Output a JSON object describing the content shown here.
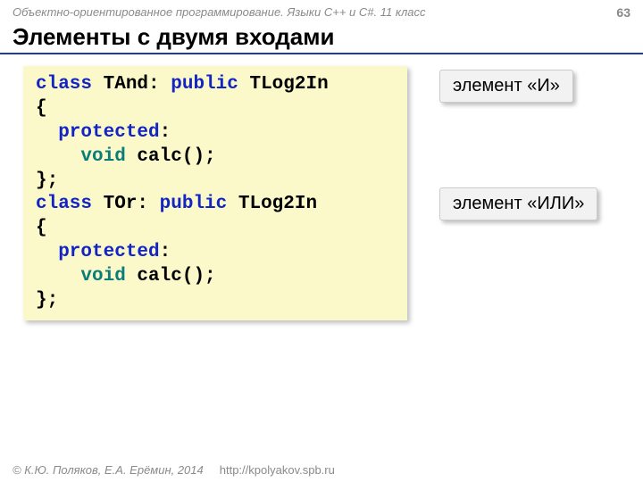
{
  "header": {
    "course": "Объектно-ориентированное программирование. Языки C++ и C#. 11 класс",
    "page": "63"
  },
  "title": "Элементы с двумя входами",
  "code": {
    "l1_kw1": "class",
    "l1_name": " TAnd: ",
    "l1_kw2": "public",
    "l1_base": " TLog2In",
    "l2": "{",
    "l3_kw": "  protected",
    "l3_colon": ":",
    "l4_kw": "    void",
    "l4_rest": " calc();",
    "l5": "};",
    "l6_kw1": "class",
    "l6_name": " TOr: ",
    "l6_kw2": "public",
    "l6_base": " TLog2In",
    "l7": "{",
    "l8_kw": "  protected",
    "l8_colon": ":",
    "l9_kw": "    void",
    "l9_rest": " calc();",
    "l10": "};"
  },
  "callouts": {
    "and": "элемент «И»",
    "or": "элемент «ИЛИ»"
  },
  "footer": {
    "copyright": "© К.Ю. Поляков, Е.А. Ерёмин, 2014",
    "url": "http://kpolyakov.spb.ru"
  }
}
